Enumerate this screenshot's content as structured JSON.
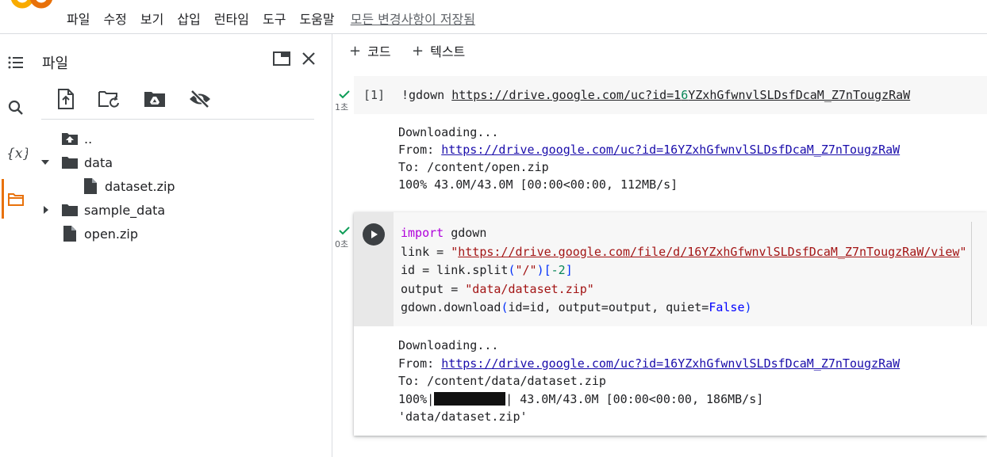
{
  "app": {
    "logo_name": "colab-logo",
    "accent_color": "#e8710a"
  },
  "menu": {
    "items": [
      "파일",
      "수정",
      "보기",
      "삽입",
      "런타임",
      "도구",
      "도움말"
    ],
    "saved_status": "모든 변경사항이 저장됨"
  },
  "file_panel": {
    "title": "파일",
    "tree": {
      "parent": "..",
      "data_folder": "data",
      "dataset_zip": "dataset.zip",
      "sample_data": "sample_data",
      "open_zip": "open.zip"
    }
  },
  "toolbar": {
    "code_label": "코드",
    "text_label": "텍스트"
  },
  "cells": {
    "cell1": {
      "prompt": "[1]",
      "exec_time": "1초",
      "code_prefix": "!gdown ",
      "code_url_a": "https://drive.google.com/uc?id=1",
      "code_url_num": "6",
      "code_url_b": "YZxhGfwnvlSLDsfDcaM_Z7nTougzRaW",
      "output_line1": "Downloading...",
      "output_from_label": "From: ",
      "output_from_url": "https://drive.google.com/uc?id=16YZxhGfwnvlSLDsfDcaM_Z7nTougzRaW",
      "output_line3": "To: /content/open.zip",
      "output_line4": "100% 43.0M/43.0M [00:00<00:00, 112MB/s]"
    },
    "cell2": {
      "exec_time": "0초",
      "line1_kw": "import",
      "line1_rest": " gdown",
      "line2_a": "link = ",
      "line2_q1": "\"",
      "line2_url": "https://drive.google.com/file/d/16YZxhGfwnvlSLDsfDcaM_Z7nTougzRaW/view",
      "line2_q2": "\"",
      "line3_a": "id = link.split",
      "line3_b": "(",
      "line3_str": "\"/\"",
      "line3_c": ")",
      "line3_d": "[",
      "line3_num": "-2",
      "line3_e": "]",
      "line4_a": "output = ",
      "line4_str": "\"data/dataset.zip\"",
      "line5_a": "gdown.download",
      "line5_b": "(",
      "line5_c": "id=id, output=output, quiet=",
      "line5_bool": "False",
      "line5_d": ")",
      "output_line1": "Downloading...",
      "output_from_label": "From: ",
      "output_from_url": "https://drive.google.com/uc?id=16YZxhGfwnvlSLDsfDcaM_Z7nTougzRaW",
      "output_line3": "To: /content/data/dataset.zip",
      "output_progress_prefix": "100%|",
      "output_progress_suffix": "| 43.0M/43.0M [00:00<00:00, 186MB/s]",
      "output_progress_value": 1.0,
      "output_result": "'data/dataset.zip'"
    }
  }
}
